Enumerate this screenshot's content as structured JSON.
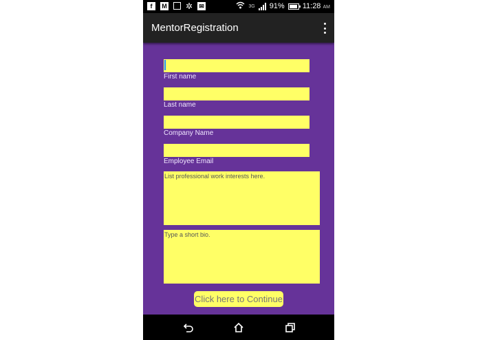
{
  "status_bar": {
    "notification_icons": [
      "facebook-icon",
      "gmail-icon",
      "nook-icon",
      "pinwheel-icon",
      "email-icon"
    ],
    "network_type": "3G",
    "battery_percent": "91%",
    "time": "11:28",
    "ampm": "AM"
  },
  "app_bar": {
    "title": "MentorRegistration",
    "overflow_icon": "more-vert-icon"
  },
  "form": {
    "first_name": {
      "label": "First name",
      "value": ""
    },
    "last_name": {
      "label": "Last name",
      "value": ""
    },
    "company_name": {
      "label": "Company Name",
      "value": ""
    },
    "employee_email": {
      "label": "Employee Email",
      "value": ""
    },
    "interests": {
      "placeholder": "List professional work interests here.",
      "value": ""
    },
    "bio": {
      "placeholder": "Type a short bio.",
      "value": ""
    },
    "field_color": "#ffff66",
    "background_color": "#663399"
  },
  "continue_button": {
    "label": "Click here to Continue"
  },
  "nav_bar": {
    "back_icon": "back-icon",
    "home_icon": "home-icon",
    "recents_icon": "recents-icon"
  }
}
